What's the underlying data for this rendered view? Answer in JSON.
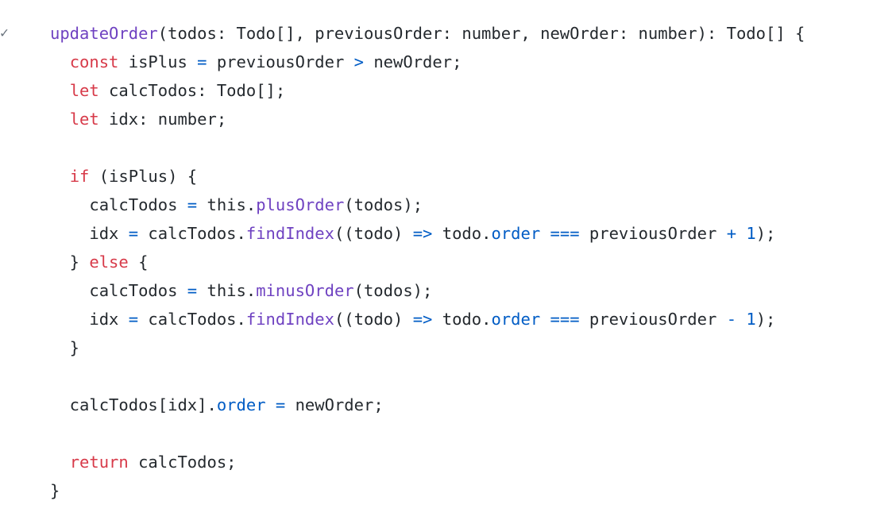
{
  "gutter": {
    "marker": "✓"
  },
  "code": {
    "lines": [
      [
        {
          "t": "updateOrder",
          "c": "fn",
          "name": "function-name"
        },
        {
          "t": "(todos: Todo[], previousOrder: number, newOrder: number): Todo[] {",
          "c": "txt"
        }
      ],
      [
        {
          "t": "  ",
          "c": "txt"
        },
        {
          "t": "const",
          "c": "kw"
        },
        {
          "t": " isPlus ",
          "c": "txt"
        },
        {
          "t": "=",
          "c": "op"
        },
        {
          "t": " previousOrder ",
          "c": "txt"
        },
        {
          "t": ">",
          "c": "op"
        },
        {
          "t": " newOrder;",
          "c": "txt"
        }
      ],
      [
        {
          "t": "  ",
          "c": "txt"
        },
        {
          "t": "let",
          "c": "kw"
        },
        {
          "t": " calcTodos: Todo[];",
          "c": "txt"
        }
      ],
      [
        {
          "t": "  ",
          "c": "txt"
        },
        {
          "t": "let",
          "c": "kw"
        },
        {
          "t": " idx: number;",
          "c": "txt"
        }
      ],
      [],
      [
        {
          "t": "  ",
          "c": "txt"
        },
        {
          "t": "if",
          "c": "kw"
        },
        {
          "t": " (isPlus) {",
          "c": "txt"
        }
      ],
      [
        {
          "t": "    calcTodos ",
          "c": "txt"
        },
        {
          "t": "=",
          "c": "op"
        },
        {
          "t": " this.",
          "c": "txt"
        },
        {
          "t": "plusOrder",
          "c": "fn"
        },
        {
          "t": "(todos);",
          "c": "txt"
        }
      ],
      [
        {
          "t": "    idx ",
          "c": "txt"
        },
        {
          "t": "=",
          "c": "op"
        },
        {
          "t": " calcTodos.",
          "c": "txt"
        },
        {
          "t": "findIndex",
          "c": "fn"
        },
        {
          "t": "((todo) ",
          "c": "txt"
        },
        {
          "t": "=>",
          "c": "op"
        },
        {
          "t": " todo.",
          "c": "txt"
        },
        {
          "t": "order",
          "c": "prop"
        },
        {
          "t": " ",
          "c": "txt"
        },
        {
          "t": "===",
          "c": "op"
        },
        {
          "t": " previousOrder ",
          "c": "txt"
        },
        {
          "t": "+",
          "c": "op"
        },
        {
          "t": " ",
          "c": "txt"
        },
        {
          "t": "1",
          "c": "num"
        },
        {
          "t": ");",
          "c": "txt"
        }
      ],
      [
        {
          "t": "  } ",
          "c": "txt"
        },
        {
          "t": "else",
          "c": "kw"
        },
        {
          "t": " {",
          "c": "txt"
        }
      ],
      [
        {
          "t": "    calcTodos ",
          "c": "txt"
        },
        {
          "t": "=",
          "c": "op"
        },
        {
          "t": " this.",
          "c": "txt"
        },
        {
          "t": "minusOrder",
          "c": "fn"
        },
        {
          "t": "(todos);",
          "c": "txt"
        }
      ],
      [
        {
          "t": "    idx ",
          "c": "txt"
        },
        {
          "t": "=",
          "c": "op"
        },
        {
          "t": " calcTodos.",
          "c": "txt"
        },
        {
          "t": "findIndex",
          "c": "fn"
        },
        {
          "t": "((todo) ",
          "c": "txt"
        },
        {
          "t": "=>",
          "c": "op"
        },
        {
          "t": " todo.",
          "c": "txt"
        },
        {
          "t": "order",
          "c": "prop"
        },
        {
          "t": " ",
          "c": "txt"
        },
        {
          "t": "===",
          "c": "op"
        },
        {
          "t": " previousOrder ",
          "c": "txt"
        },
        {
          "t": "-",
          "c": "op"
        },
        {
          "t": " ",
          "c": "txt"
        },
        {
          "t": "1",
          "c": "num"
        },
        {
          "t": ");",
          "c": "txt"
        }
      ],
      [
        {
          "t": "  }",
          "c": "txt"
        }
      ],
      [],
      [
        {
          "t": "  calcTodos[idx].",
          "c": "txt"
        },
        {
          "t": "order",
          "c": "prop"
        },
        {
          "t": " ",
          "c": "txt"
        },
        {
          "t": "=",
          "c": "op"
        },
        {
          "t": " newOrder;",
          "c": "txt"
        }
      ],
      [],
      [
        {
          "t": "  ",
          "c": "txt"
        },
        {
          "t": "return",
          "c": "kw"
        },
        {
          "t": " calcTodos;",
          "c": "txt"
        }
      ],
      [
        {
          "t": "}",
          "c": "txt"
        }
      ]
    ]
  },
  "colors": {
    "keyword": "#d73a49",
    "function": "#6f42c1",
    "property": "#005cc5",
    "plain": "#24292e"
  }
}
